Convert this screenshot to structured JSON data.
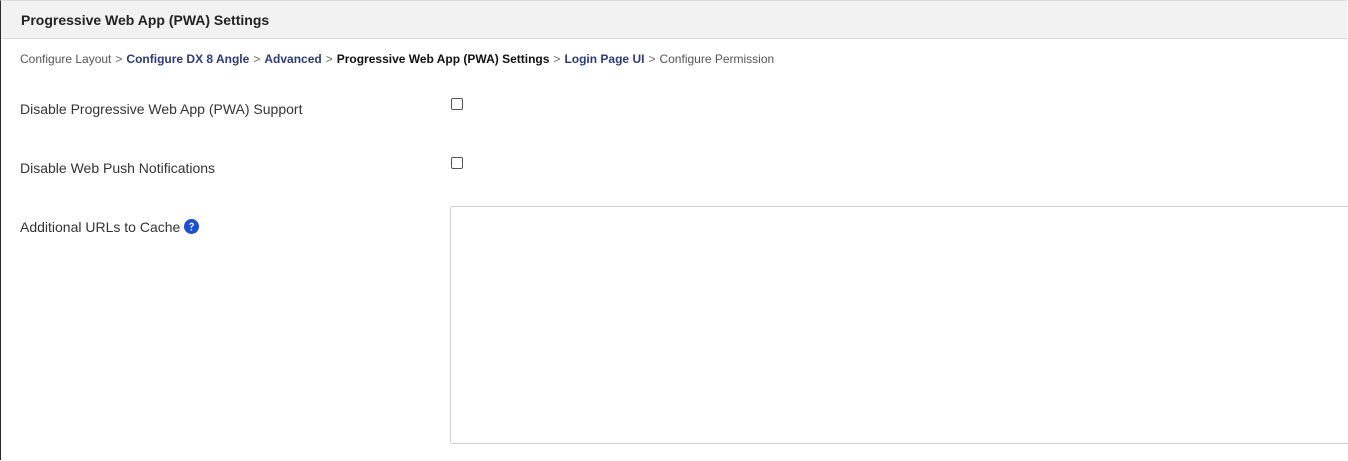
{
  "header": {
    "title": "Progressive Web App (PWA) Settings"
  },
  "breadcrumb": {
    "items": [
      {
        "label": "Configure Layout",
        "style": "plain"
      },
      {
        "label": "Configure DX 8 Angle",
        "style": "link"
      },
      {
        "label": "Advanced",
        "style": "link"
      },
      {
        "label": "Progressive Web App (PWA) Settings",
        "style": "current"
      },
      {
        "label": "Login Page UI",
        "style": "link"
      },
      {
        "label": "Configure Permission",
        "style": "plain"
      }
    ],
    "separator": ">"
  },
  "form": {
    "disable_pwa_support": {
      "label": "Disable Progressive Web App (PWA) Support",
      "checked": false
    },
    "disable_web_push": {
      "label": "Disable Web Push Notifications",
      "checked": false
    },
    "additional_urls": {
      "label": "Additional URLs to Cache",
      "value": "",
      "help_icon": "question-circle-icon"
    }
  },
  "colors": {
    "link": "#2c3a7c",
    "help_icon": "#1a4fd6",
    "title_bar_bg": "#f2f2f2"
  }
}
